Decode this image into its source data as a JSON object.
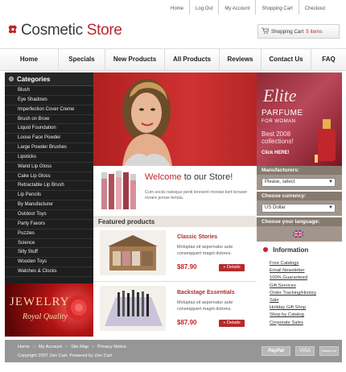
{
  "top_links": [
    "Home",
    "Log Out",
    "My Account",
    "Shopping Cart",
    "Checkout"
  ],
  "logo": {
    "part1": "Cosmetic",
    "part2": "Store"
  },
  "cart": {
    "label": "Shopping Cart",
    "count": "5 items"
  },
  "nav": [
    "Home",
    "Specials",
    "New Products",
    "All Products",
    "Reviews",
    "Contact Us",
    "FAQ"
  ],
  "sidebar": {
    "heading": "Categories",
    "items": [
      "Blush",
      "Eye Shadows",
      "Imperfection Cover Creme",
      "Brush on Brow",
      "Liquid Foundation",
      "Loose Face Powder",
      "Large Powder Brushes",
      "Lipsticks",
      "Wand Lip Gloss",
      "Cake Lip Gloss",
      "Retractable Lip Brush",
      "Lip Pencils",
      "By Manufacturer",
      "Outdoor Toys",
      "Party Favors",
      "Puzzles",
      "Science",
      "Silly Stuff",
      "Wooden Toys",
      "Watches & Clocks"
    ]
  },
  "jewelry_banner": {
    "title": "JEWELRY",
    "subtitle": "Royal Quality"
  },
  "welcome": {
    "prefix": "Welcome",
    "suffix": " to our Store!",
    "text": "Cum sociis natoque penti lereserit monise kert lerswer rivrare jerose lertsta."
  },
  "featured": {
    "heading": "Featured products",
    "products": [
      {
        "name": "Classic Stories",
        "desc": "Moluptas sit aspernatur aute conseqquert magni dolores.",
        "price": "$87.90",
        "button": "Details"
      },
      {
        "name": "Backstage Essentials",
        "desc": "Moluptas sit aspernatur aute conseqquert magni dolores.",
        "price": "$87.90",
        "button": "Details"
      }
    ]
  },
  "elite_banner": {
    "title": "Elite",
    "line1": "PARFUME",
    "line2": "FOR WOMAN",
    "line3": "Best 2008 collections!",
    "cta": "Click HERE!"
  },
  "manufacturers": {
    "heading": "Manufacturers:",
    "selected": "Please, select"
  },
  "currency": {
    "heading": "Choose currency:",
    "selected": "US Dollar"
  },
  "language": {
    "heading": "Choose your language:"
  },
  "information": {
    "heading": "Information",
    "links": [
      "Free Catalogs",
      "Email Newsletter",
      "100% Guaranteed",
      "Gift Services",
      "Order Tracking/History",
      "Sale",
      "Holiday Gift Shop",
      "Shop by Catalog",
      "Corporate Sales"
    ]
  },
  "footer": {
    "links": [
      "Home",
      "::",
      "My Account",
      "::",
      "Site Map",
      "::",
      "Privacy Notice"
    ],
    "copyright": "Copyright  2007 Zen Cart. Powered by Zen Cart"
  },
  "payments": [
    "PayPal",
    "VISA",
    "MasterCard"
  ],
  "colors": {
    "accent": "#c0262c",
    "sidebar": "#1e1e1e",
    "panel": "#a2968c",
    "footer": "#969696"
  }
}
